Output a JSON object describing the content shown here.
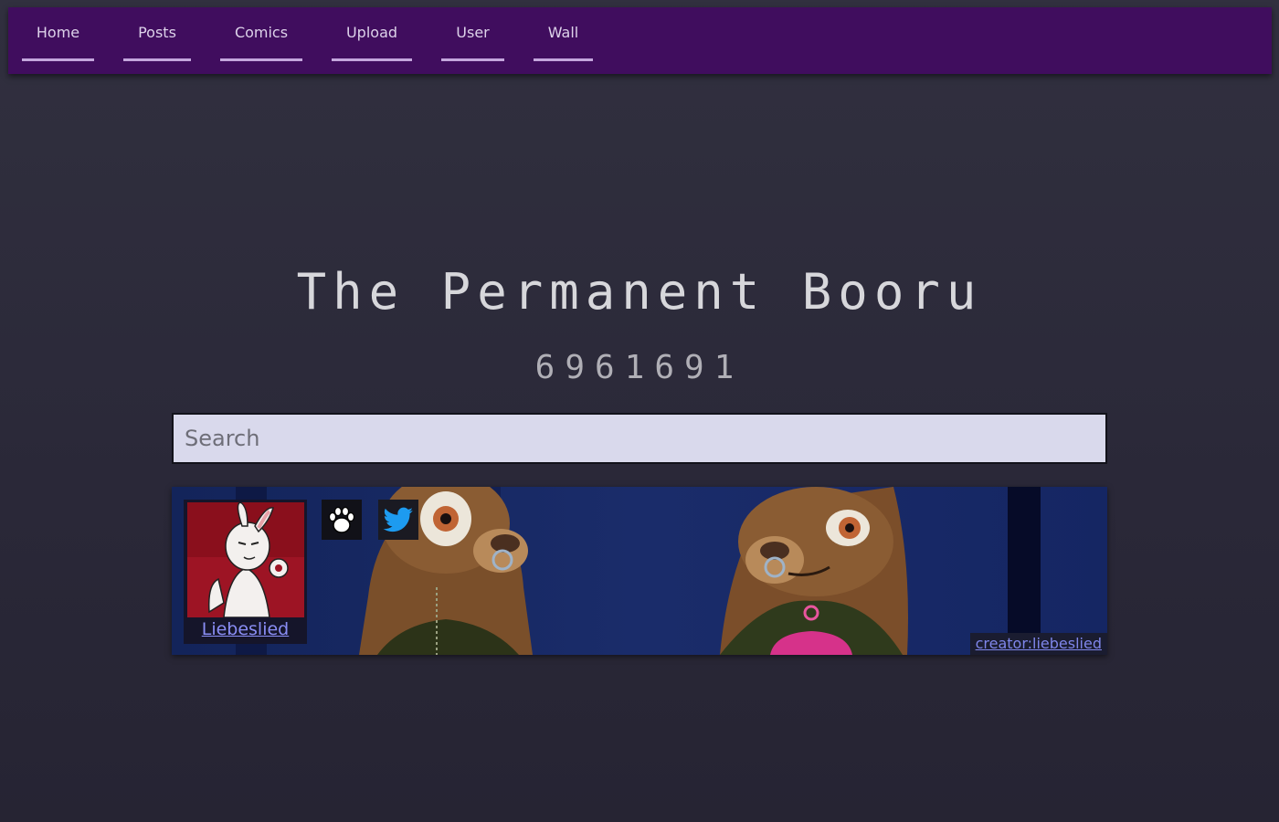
{
  "nav": {
    "items": [
      {
        "label": "Home"
      },
      {
        "label": "Posts"
      },
      {
        "label": "Comics"
      },
      {
        "label": "Upload"
      },
      {
        "label": "User"
      },
      {
        "label": "Wall"
      }
    ]
  },
  "site": {
    "title": "The Permanent Booru",
    "post_count": "6961691"
  },
  "search": {
    "placeholder": "Search",
    "value": ""
  },
  "banner": {
    "artist_name": "Liebeslied",
    "creator_tag": "creator:liebeslied",
    "links": [
      {
        "icon": "paw-icon"
      },
      {
        "icon": "twitter-icon"
      }
    ]
  },
  "colors": {
    "navbar": "#400d5e",
    "nav_underline": "#c4a6dd",
    "background": "#2c2b3a",
    "search_bg": "#d9d9ec",
    "link": "#8a8ef5",
    "banner_bg": "#16275f",
    "twitter": "#1d9bf0"
  }
}
